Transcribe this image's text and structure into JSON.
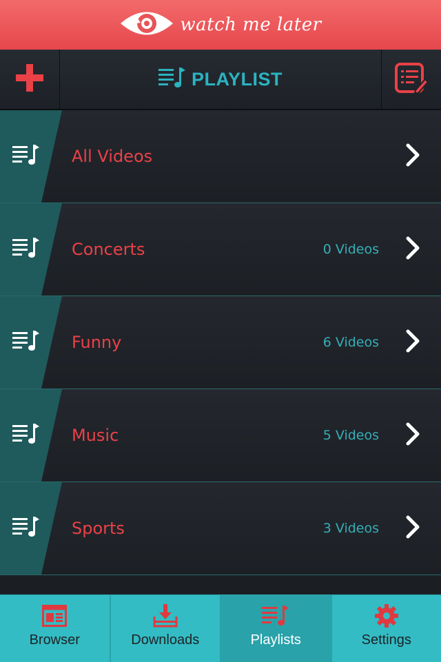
{
  "header": {
    "brand_text": "watch me later"
  },
  "titlebar": {
    "title": "PLAYLIST",
    "add_icon": "plus-icon",
    "edit_icon": "edit-list-icon"
  },
  "playlists": [
    {
      "name": "All Videos",
      "count": ""
    },
    {
      "name": "Concerts",
      "count": "0 Videos"
    },
    {
      "name": "Funny",
      "count": "6 Videos"
    },
    {
      "name": "Music",
      "count": "5 Videos"
    },
    {
      "name": "Sports",
      "count": "3 Videos"
    }
  ],
  "tabs": [
    {
      "label": "Browser",
      "icon": "browser-icon",
      "active": false
    },
    {
      "label": "Downloads",
      "icon": "download-icon",
      "active": false
    },
    {
      "label": "Playlists",
      "icon": "playlist-icon",
      "active": true
    },
    {
      "label": "Settings",
      "icon": "gear-icon",
      "active": false
    }
  ],
  "colors": {
    "header_red": "#ea4b50",
    "accent_teal": "#2bb3c0",
    "label_red": "#ea4147",
    "tabbar": "#33bcc4"
  }
}
